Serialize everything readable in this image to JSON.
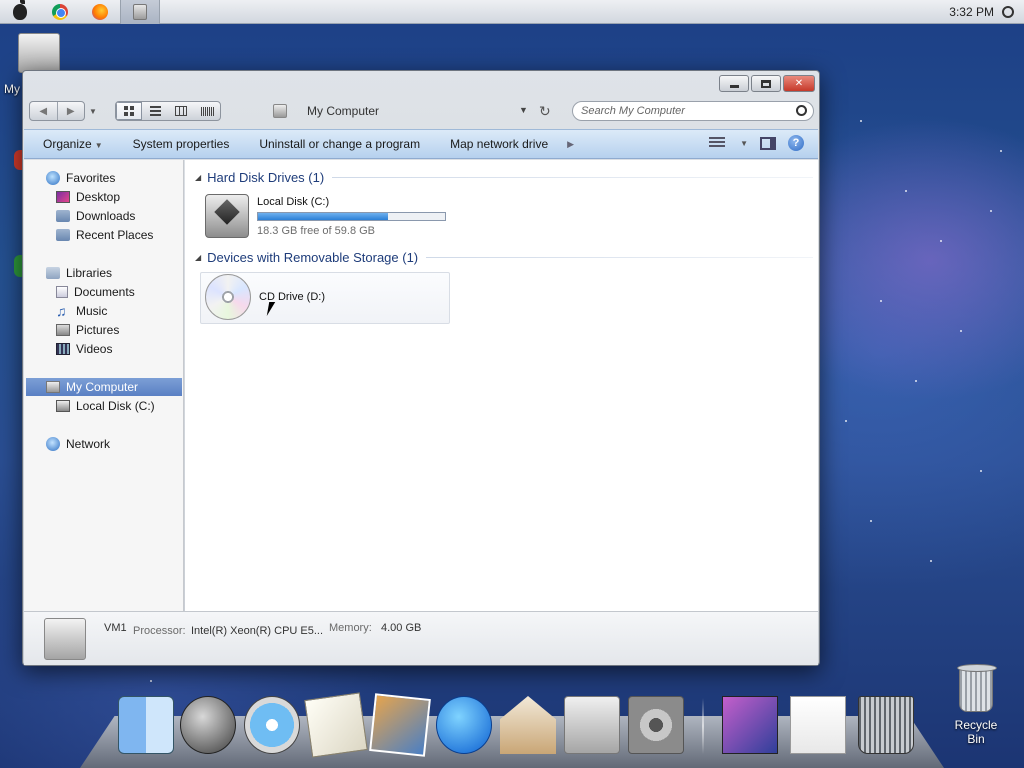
{
  "menubar": {
    "clock": "3:32 PM",
    "icons": [
      "apple-icon",
      "chrome-icon",
      "firefox-icon",
      "computer-icon",
      "spotlight-icon"
    ]
  },
  "desktop": {
    "pc_label": "My",
    "recycle_bin_label": "Recycle Bin"
  },
  "window": {
    "address": "My Computer",
    "search_placeholder": "Search My Computer",
    "commands": {
      "organize": "Organize",
      "system_properties": "System properties",
      "uninstall": "Uninstall or change a program",
      "map_drive": "Map network drive"
    },
    "nav": {
      "favorites": "Favorites",
      "desktop": "Desktop",
      "downloads": "Downloads",
      "recent_places": "Recent Places",
      "libraries": "Libraries",
      "documents": "Documents",
      "music": "Music",
      "pictures": "Pictures",
      "videos": "Videos",
      "my_computer": "My Computer",
      "local_disk": "Local Disk (C:)",
      "network": "Network"
    },
    "groups": {
      "hdd_header": "Hard Disk Drives (1)",
      "removable_header": "Devices with Removable Storage (1)"
    },
    "drives": {
      "c_name": "Local Disk (C:)",
      "c_free": "18.3 GB free of 59.8 GB",
      "c_used_fraction": 0.694,
      "d_name": "CD Drive (D:)"
    },
    "details": {
      "name": "VM1",
      "processor_label": "Processor:",
      "processor_value": "Intel(R) Xeon(R) CPU E5...",
      "memory_label": "Memory:",
      "memory_value": "4.00 GB"
    }
  },
  "dock": {
    "items": [
      "finder-icon",
      "launchpad-icon",
      "safari-icon",
      "mail-icon",
      "photo-icon",
      "itunes-icon",
      "home-icon",
      "macpro-icon",
      "system-prefs-icon",
      "lion-icon",
      "document-icon",
      "trash-icon"
    ]
  }
}
